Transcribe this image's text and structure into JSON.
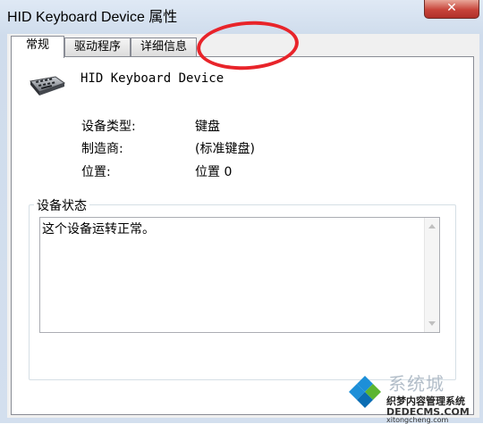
{
  "window": {
    "title": "HID Keyboard Device 属性",
    "close_label": "✕"
  },
  "tabs": [
    {
      "label": "常规",
      "active": true
    },
    {
      "label": "驱动程序",
      "active": false
    },
    {
      "label": "详细信息",
      "active": false
    }
  ],
  "device": {
    "name": "HID Keyboard Device",
    "icon": "keyboard-icon"
  },
  "properties": [
    {
      "label": "设备类型:",
      "value": "键盘"
    },
    {
      "label": "制造商:",
      "value": "(标准键盘)"
    },
    {
      "label": "位置:",
      "value": "位置 0"
    }
  ],
  "status_group": {
    "label": "设备状态",
    "text": "这个设备运转正常。"
  },
  "annotation": {
    "color": "#e8242a"
  },
  "watermark": {
    "text": "系统城",
    "line1": "织梦内容管理系统",
    "line2": "DEDECMS.COM",
    "line3": "xitongcheng.com"
  }
}
